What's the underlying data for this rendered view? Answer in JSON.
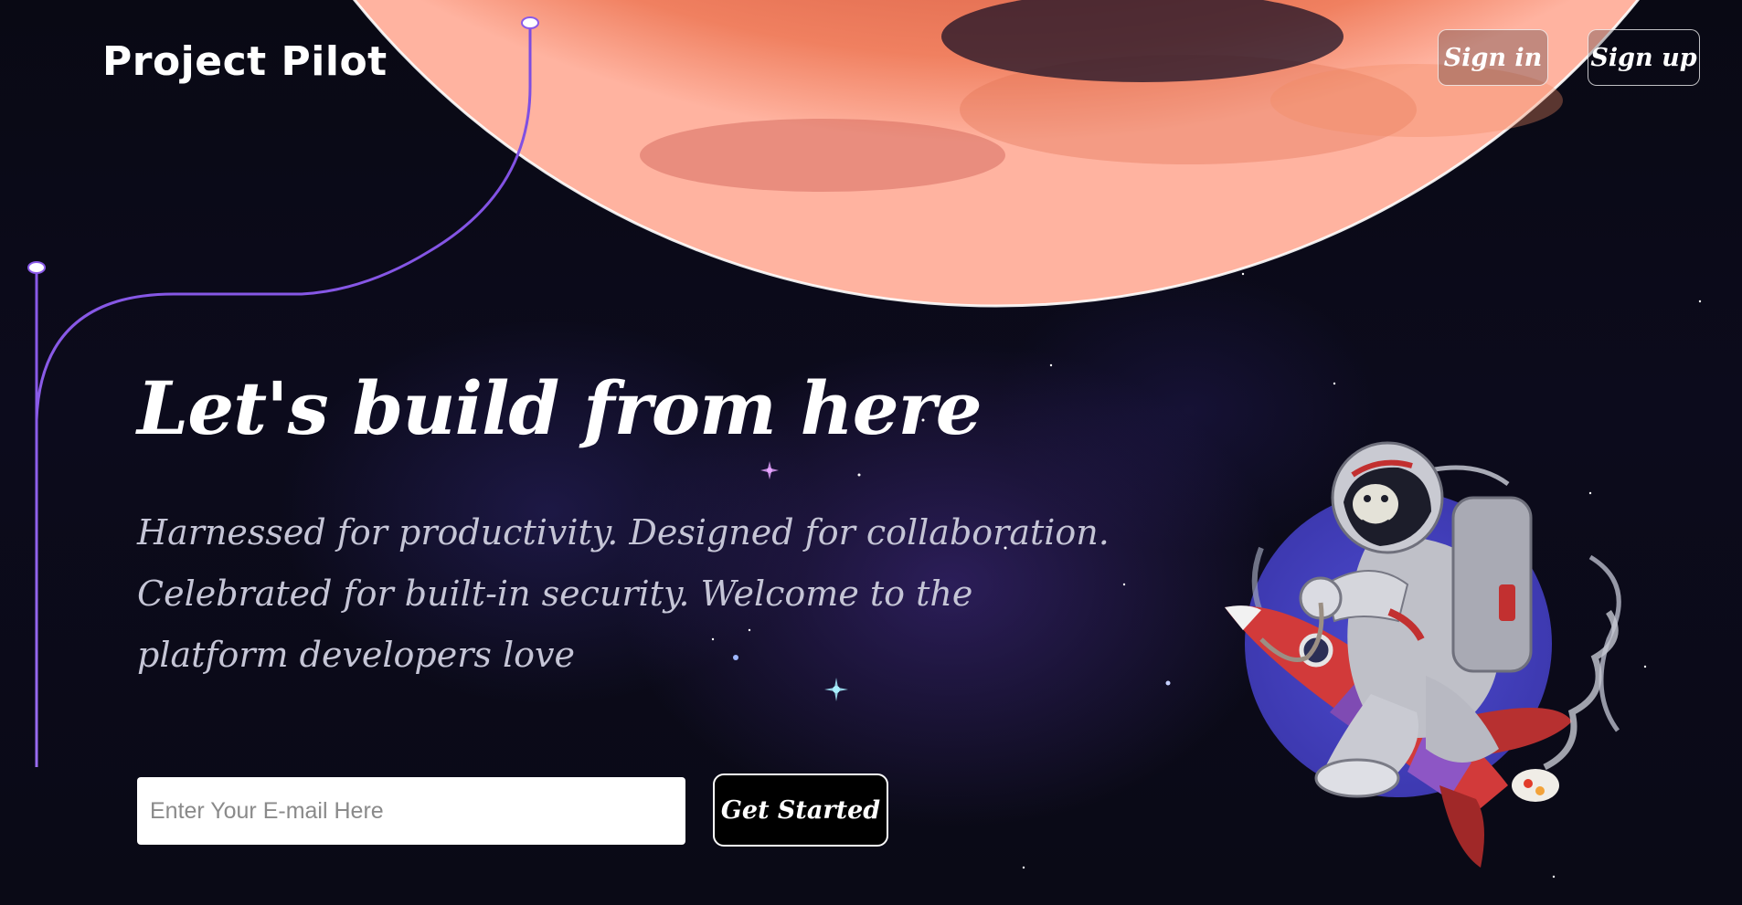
{
  "header": {
    "logo_text": "Project Pilot",
    "sign_in_label": "Sign in",
    "sign_up_label": "Sign up"
  },
  "hero": {
    "headline": "Let's build from here",
    "subtext": "Harnessed for productivity. Designed for collaboration. Celebrated for built-in security. Welcome to the platform developers love"
  },
  "signup_form": {
    "email_placeholder": "Enter Your E-mail Here",
    "email_value": "",
    "cta_label": "Get Started"
  },
  "colors": {
    "accent_line": "#6a3fd1",
    "planet_orange": "#d9603f",
    "planet_rim": "#ffffff",
    "background": "#08080f",
    "button_bg": "#000000"
  },
  "icons": [
    "planet-illustration",
    "astronaut-rocket-illustration",
    "timeline-node-icon",
    "star-icon"
  ]
}
